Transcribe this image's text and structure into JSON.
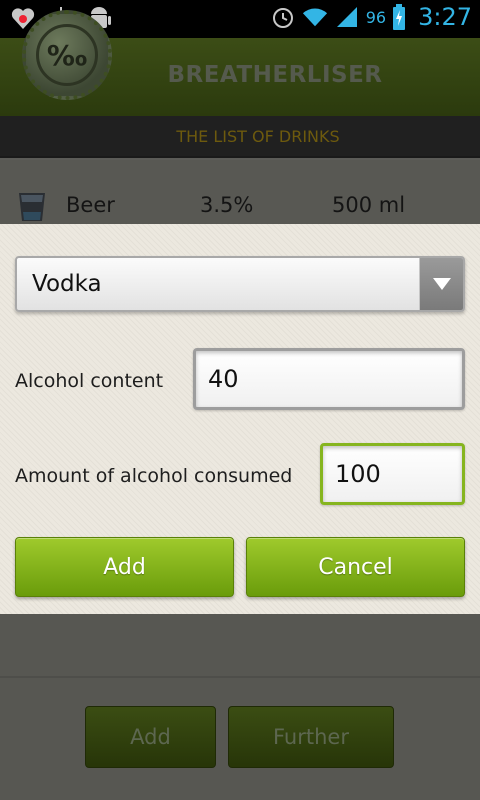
{
  "status_bar": {
    "battery_percent": "96",
    "time": "3:27",
    "icons": [
      "heart-notification-icon",
      "usb-icon",
      "android-debug-icon",
      "alarm-icon",
      "wifi-icon",
      "signal-icon",
      "battery-charging-icon"
    ],
    "icon_color": "#33b5e5"
  },
  "header": {
    "logo_text": "‰",
    "title": "BREATHERLISER",
    "subtitle": "THE LIST OF DRINKS"
  },
  "drinks": [
    {
      "name": "Beer",
      "alcohol": "3.5%",
      "volume": "500 ml",
      "icon": "glass-icon"
    }
  ],
  "dialog": {
    "drink_select": {
      "selected": "Vodka"
    },
    "alcohol_content": {
      "label": "Alcohol content",
      "value": "40"
    },
    "amount_consumed": {
      "label": "Amount of alcohol consumed",
      "value": "100"
    },
    "add_label": "Add",
    "cancel_label": "Cancel"
  },
  "footer": {
    "add_label": "Add",
    "further_label": "Further"
  },
  "colors": {
    "accent_green": "#86b51f",
    "button_green": "#7eaf14",
    "status_blue": "#33b5e5"
  }
}
